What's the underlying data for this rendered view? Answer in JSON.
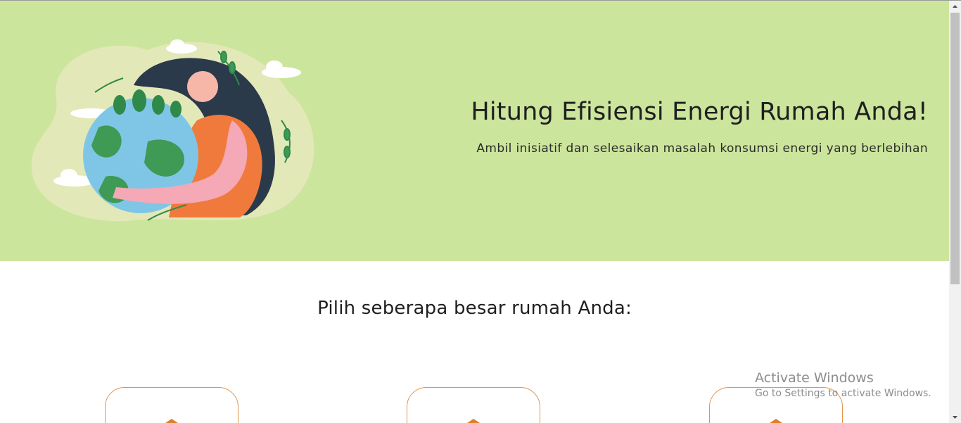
{
  "hero": {
    "title": "Hitung Efisiensi Energi Rumah Anda!",
    "subtitle": "Ambil inisiatif dan selesaikan masalah konsumsi energi yang berlebihan",
    "background_color": "#cce59c",
    "illustration": "woman-hugging-earth-illustration"
  },
  "house_size": {
    "heading": "Pilih seberapa besar rumah Anda:",
    "options": [
      {
        "icon": "house-icon"
      },
      {
        "icon": "house-icon"
      },
      {
        "icon": "house-icon"
      }
    ],
    "accent_color": "#e0954a"
  },
  "os_watermark": {
    "title": "Activate Windows",
    "subtitle": "Go to Settings to activate Windows."
  }
}
